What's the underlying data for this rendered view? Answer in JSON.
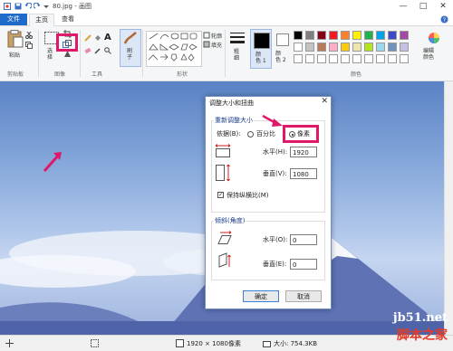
{
  "window": {
    "title": "80.jpg - 画图",
    "minimize": "—",
    "maximize": "□",
    "close": "✕"
  },
  "tabs": [
    {
      "label": "文件"
    },
    {
      "label": "主页"
    },
    {
      "label": "查看"
    }
  ],
  "ribbon": {
    "clipboard": {
      "paste": "粘贴",
      "group": "剪贴板"
    },
    "image": {
      "select": "选\n择",
      "group": "图像"
    },
    "tools": {
      "group": "工具",
      "text_tool": "A"
    },
    "brushes": {
      "label": "刷\n子"
    },
    "shapes": {
      "group": "形状",
      "outline": "轮廓",
      "fill": "填充"
    },
    "size": {
      "label": "粗\n细"
    },
    "color1": {
      "label": "颜\n色 1"
    },
    "color2": {
      "label": "颜\n色 2"
    },
    "colors": {
      "group": "颜色",
      "edit": "编辑\n颜色"
    },
    "palette": [
      "#000000",
      "#7f7f7f",
      "#880015",
      "#ed1c24",
      "#ff7f27",
      "#fff200",
      "#22b14c",
      "#00a2e8",
      "#3f48cc",
      "#a349a4",
      "#ffffff",
      "#c3c3c3",
      "#b97a57",
      "#ffaec9",
      "#ffc90e",
      "#efe4b0",
      "#b5e61d",
      "#99d9ea",
      "#7092be",
      "#c8bfe7",
      "#ffffff",
      "#ffffff",
      "#ffffff",
      "#ffffff",
      "#ffffff",
      "#ffffff",
      "#ffffff",
      "#ffffff",
      "#ffffff",
      "#ffffff"
    ]
  },
  "dialog": {
    "title": "调整大小和扭曲",
    "close": "✕",
    "resize": {
      "legend": "重新调整大小",
      "by_label": "依据(B):",
      "percent_label": "百分比",
      "pixels_label": "像素",
      "horizontal_label": "水平(H):",
      "horizontal_value": "1920",
      "vertical_label": "垂直(V):",
      "vertical_value": "1080",
      "keep_ratio_label": "保持纵横比(M)",
      "keep_ratio_checked": true
    },
    "skew": {
      "legend": "倾斜(角度)",
      "horizontal_label": "水平(O):",
      "horizontal_value": "0",
      "vertical_label": "垂直(E):",
      "vertical_value": "0"
    },
    "ok": "确定",
    "cancel": "取消"
  },
  "status": {
    "dimensions": "1920 × 1080像素",
    "size": "大小: 754.3KB"
  },
  "watermark": {
    "site": "jb51.net",
    "name": "脚本之家"
  },
  "colors": {
    "accent": "#1e6bc9",
    "highlight": "#e0186a"
  }
}
